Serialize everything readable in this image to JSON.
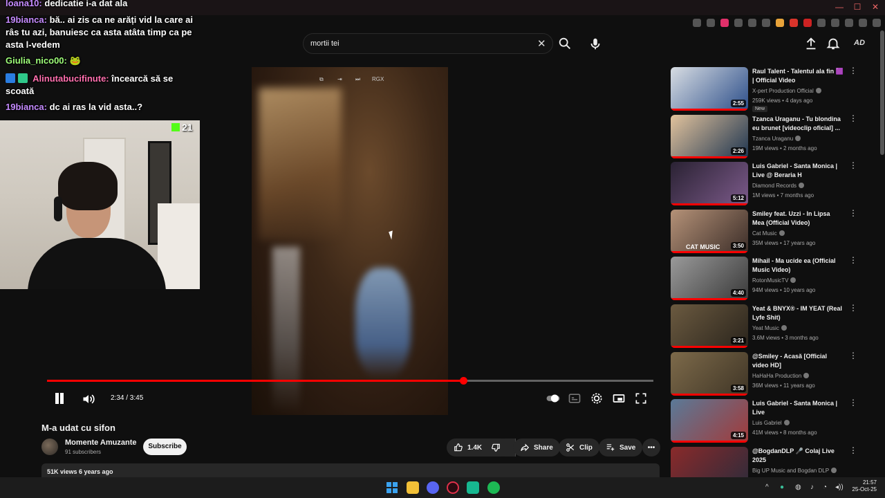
{
  "browser": {
    "window_controls": [
      "—",
      "☐",
      "✕"
    ]
  },
  "search": {
    "value": "mortii tei"
  },
  "video": {
    "overlay_label": "RGX",
    "progress": 0.686,
    "timecode": "2:34 / 3:45",
    "title": "M-a udat cu sifon",
    "channel": "Momente Amuzante",
    "subscribers": "91 subscribers",
    "subscribe_label": "Subscribe",
    "likes": "1.4K",
    "share_label": "Share",
    "clip_label": "Clip",
    "save_label": "Save",
    "views_date": "51K views  6 years ago"
  },
  "recommendations": [
    {
      "title": "Raul Talent - Talentul ala fin 🟪 | Official Video",
      "channel": "X-pert Production Official",
      "meta": "259K views • 4 days ago",
      "duration": "2:55",
      "badge": "New",
      "colors": [
        "#d8dde3",
        "#2d4f8a"
      ]
    },
    {
      "title": "Tzanca Uraganu - Tu blondina eu brunet [videoclip oficial] ...",
      "channel": "Tzanca Uraganu",
      "meta": "19M views • 2 months ago",
      "duration": "2:26",
      "colors": [
        "#e2c39d",
        "#1e3550"
      ]
    },
    {
      "title": "Luis Gabriel - Santa Monica | Live @ Beraria H",
      "channel": "Diamond Records",
      "meta": "1M views • 7 months ago",
      "duration": "5:12",
      "colors": [
        "#2a2233",
        "#7c5a8a"
      ]
    },
    {
      "title": "Smiley feat. Uzzi - In Lipsa Mea (Official Video)",
      "channel": "Cat Music",
      "meta": "35M views • 17 years ago",
      "duration": "3:50",
      "overlay": "CAT MUSIC",
      "colors": [
        "#b59278",
        "#3b2d28"
      ]
    },
    {
      "title": "Mihail - Ma ucide ea (Official Music Video)",
      "channel": "RotonMusicTV",
      "meta": "94M views • 10 years ago",
      "duration": "4:40",
      "colors": [
        "#9a9a9a",
        "#3a3a3a"
      ]
    },
    {
      "title": "Yeat & BNYX® - IM YEAT (Real Lyfe Shit)",
      "channel": "Yeat Music",
      "meta": "3.6M views • 3 months ago",
      "duration": "3:21",
      "colors": [
        "#6b5a40",
        "#2a241c"
      ]
    },
    {
      "title": "@Smiley - Acasă [Official video HD]",
      "channel": "HaHaHa Production",
      "meta": "36M views • 11 years ago",
      "duration": "3:58",
      "colors": [
        "#7d6a4a",
        "#3f3526"
      ]
    },
    {
      "title": "Luis Gabriel - Santa Monica | Live",
      "channel": "Luis Gabriel",
      "meta": "41M views • 8 months ago",
      "duration": "4:15",
      "colors": [
        "#5a7a98",
        "#a23a3a"
      ]
    },
    {
      "title": "@BogdanDLP 🎤 Colaj Live 2025",
      "channel": "Big UP Music and Bogdan DLP",
      "meta": "",
      "duration": "",
      "colors": [
        "#8a2a2a",
        "#2b2b3b"
      ]
    }
  ],
  "chat": [
    {
      "user": "Ioana10:",
      "text": "dedicatie i-a dat ala",
      "color": "#c58bff"
    },
    {
      "user": "19bianca:",
      "text": "bă.. ai zis ca ne arăți vid la care ai râs tu azi, banuiesc ca asta atâta timp ca pe asta l-vedem",
      "color": "#c58bff"
    },
    {
      "user": "Giulia_nico00:",
      "text": "🐸",
      "color": "#9fff7a"
    },
    {
      "user": "Alinutabucifinute:",
      "text": "încearcă să se scoată",
      "color": "#ff6fae"
    },
    {
      "user": "19bianca:",
      "text": "dc ai ras la vid asta..?",
      "color": "#c58bff"
    }
  ],
  "stream": {
    "viewer_count": "21"
  },
  "taskbar": {
    "time": "21:57",
    "date": "25-Oct-25"
  }
}
